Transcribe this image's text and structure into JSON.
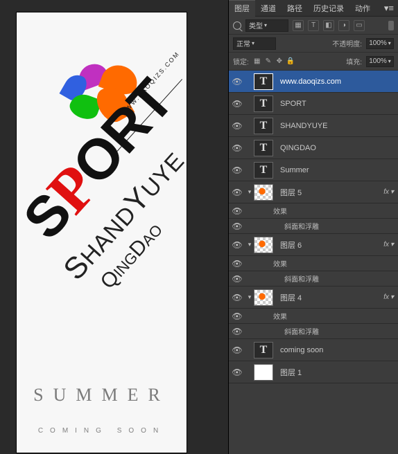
{
  "canvas": {
    "url_label": "WWW.DAOQIZS.COM",
    "sport": {
      "s1": "S",
      "p": "P",
      "s2": "ORT"
    },
    "shandyuye": {
      "cap1": "S",
      "mid": "HAND",
      "cap2": "Y",
      "end": "UYE"
    },
    "qingdao": {
      "q": "Q",
      "ing": "ING",
      "d": "D",
      "ao": "AO"
    },
    "summer": "SUMMER",
    "coming_soon": "COMING SOON"
  },
  "tabs": [
    "图层",
    "通道",
    "路径",
    "历史记录",
    "动作"
  ],
  "tabs_active": 0,
  "filter": {
    "label": "类型",
    "icons": [
      "▦",
      "T",
      "◧",
      "◑",
      "▭"
    ]
  },
  "blend": {
    "mode": "正常",
    "opacity_label": "不透明度:",
    "opacity_value": "100%"
  },
  "lock": {
    "label": "锁定:",
    "fill_label": "填充:",
    "fill_value": "100%"
  },
  "fx_label": "fx",
  "effects_label": "效果",
  "bevel_label": "斜面和浮雕",
  "layers": [
    {
      "kind": "T",
      "name": "www.daoqizs.com",
      "selected": true
    },
    {
      "kind": "T",
      "name": "SPORT"
    },
    {
      "kind": "T",
      "name": "SHANDYUYE"
    },
    {
      "kind": "T",
      "name": "QINGDAO"
    },
    {
      "kind": "T",
      "name": "Summer"
    },
    {
      "kind": "chk",
      "name": "图层 5",
      "fx": true,
      "open": true
    },
    {
      "kind": "chk",
      "name": "图层 6",
      "fx": true,
      "open": true
    },
    {
      "kind": "chk",
      "name": "图层 4",
      "fx": true,
      "open": true
    },
    {
      "kind": "T",
      "name": "coming soon"
    },
    {
      "kind": "white",
      "name": "图层 1"
    }
  ]
}
